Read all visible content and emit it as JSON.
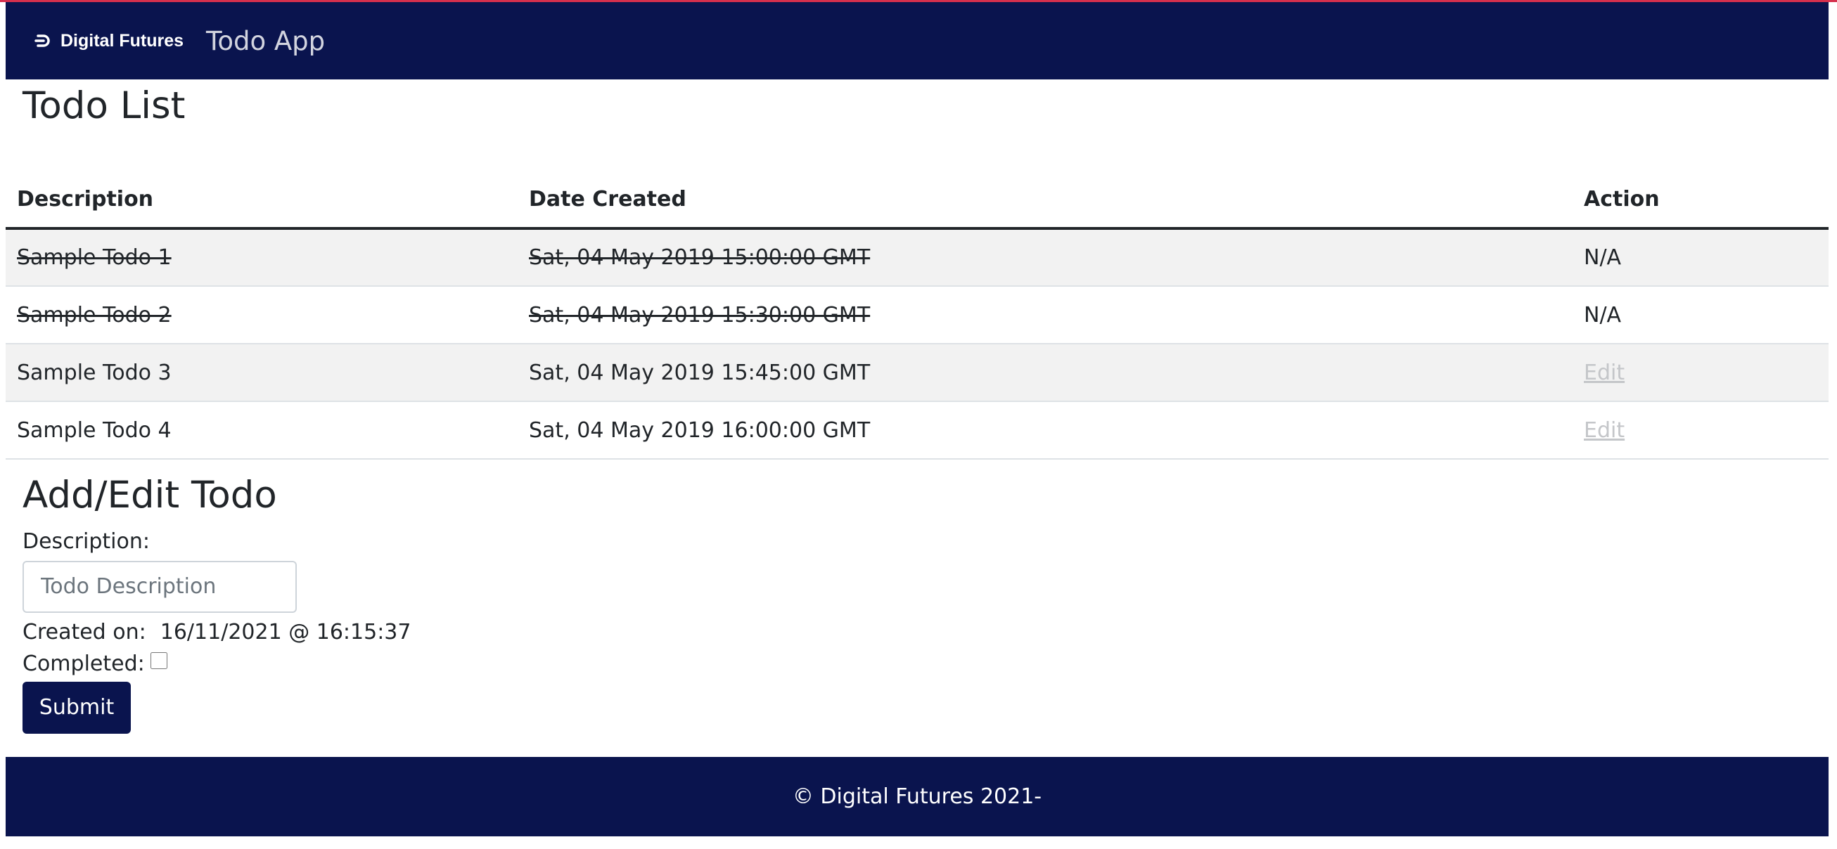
{
  "navbar": {
    "brand": "Digital Futures",
    "brand_icon": "digital-futures-logo",
    "title": "Todo App",
    "background": "#0a144e",
    "accent": "#d6304d"
  },
  "todo_list": {
    "title": "Todo List",
    "columns": [
      "Description",
      "Date Created",
      "Action"
    ],
    "rows": [
      {
        "description": "Sample Todo 1",
        "date": "Sat, 04 May 2019 15:00:00 GMT",
        "action": "N/A",
        "completed": true
      },
      {
        "description": "Sample Todo 2",
        "date": "Sat, 04 May 2019 15:30:00 GMT",
        "action": "N/A",
        "completed": true
      },
      {
        "description": "Sample Todo 3",
        "date": "Sat, 04 May 2019 15:45:00 GMT",
        "action": "Edit",
        "completed": false
      },
      {
        "description": "Sample Todo 4",
        "date": "Sat, 04 May 2019 16:00:00 GMT",
        "action": "Edit",
        "completed": false
      }
    ]
  },
  "form": {
    "title": "Add/Edit Todo",
    "description_label": "Description:",
    "description_value": "",
    "description_placeholder": "Todo Description",
    "created_label": "Created on:",
    "created_value": "16/11/2021 @ 16:15:37",
    "completed_label": "Completed:",
    "completed_checked": false,
    "submit_label": "Submit"
  },
  "footer": {
    "text": "© Digital Futures 2021-"
  }
}
